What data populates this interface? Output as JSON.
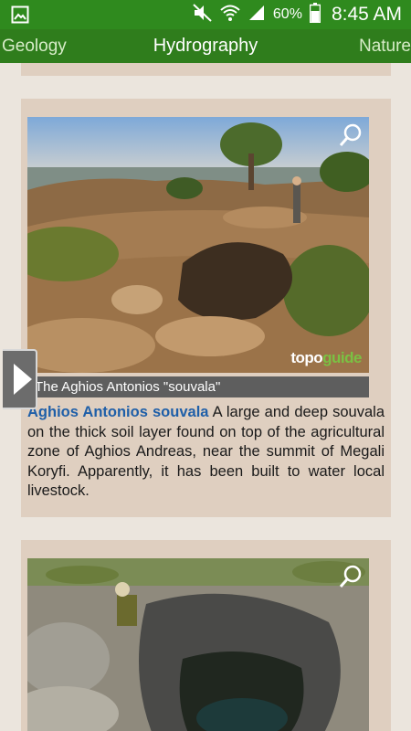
{
  "status_bar": {
    "battery_percent": "60%",
    "time": "8:45 AM",
    "icons": [
      "image-icon",
      "mute-icon",
      "wifi-icon",
      "signal-icon",
      "battery-icon"
    ]
  },
  "tabs": [
    {
      "label": "Geology"
    },
    {
      "label": "Hydrography"
    },
    {
      "label": "Nature"
    }
  ],
  "items": [
    {
      "caption": "The Aghios Antonios \"souvala\"",
      "title": "Aghios Antonios souvala",
      "description": " A large and deep souvala on the thick soil layer found on top of the agricultural zone of Aghios Andreas, near the summit of Megali Koryfi. Apparently, it has been built to water local livestock.",
      "watermark": {
        "part1": "topo",
        "part2": "guide"
      }
    }
  ],
  "colors": {
    "status_bar": "#2f8a1e",
    "tab_bar": "#2f7d1c",
    "card": "#dfcfc0",
    "background": "#ebe5dd",
    "link": "#1f5fa8"
  }
}
